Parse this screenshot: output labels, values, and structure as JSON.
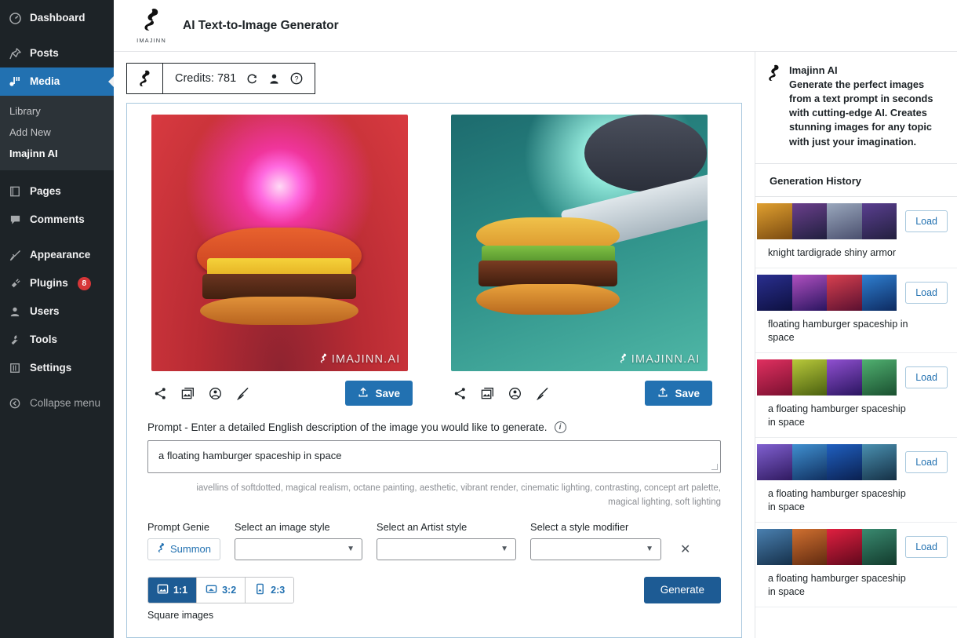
{
  "sidebar": {
    "items": [
      {
        "label": "Dashboard",
        "icon": "dashboard-icon",
        "glyph": "◕"
      },
      {
        "label": "Posts",
        "icon": "pin-icon",
        "glyph": "✚"
      },
      {
        "label": "Media",
        "icon": "media-icon",
        "glyph": "♪",
        "active": true
      },
      {
        "label": "Pages",
        "icon": "pages-icon",
        "glyph": "▤"
      },
      {
        "label": "Comments",
        "icon": "comments-icon",
        "glyph": "▬"
      },
      {
        "label": "Appearance",
        "icon": "brush-icon",
        "glyph": "✎"
      },
      {
        "label": "Plugins",
        "icon": "plug-icon",
        "glyph": "▰",
        "badge": "8"
      },
      {
        "label": "Users",
        "icon": "users-icon",
        "glyph": "♟"
      },
      {
        "label": "Tools",
        "icon": "tools-icon",
        "glyph": "✂"
      },
      {
        "label": "Settings",
        "icon": "settings-icon",
        "glyph": "▣"
      },
      {
        "label": "Collapse menu",
        "icon": "collapse-icon",
        "glyph": "◀"
      }
    ],
    "media_submenu": [
      {
        "label": "Library"
      },
      {
        "label": "Add New"
      },
      {
        "label": "Imajinn AI",
        "current": true
      }
    ]
  },
  "header": {
    "brand_word": "IMAJINN",
    "title": "AI Text-to-Image Generator"
  },
  "credits": {
    "label": "Credits: 781",
    "refresh_icon": "refresh-icon",
    "account_icon": "account-icon",
    "help_icon": "help-icon"
  },
  "results": [
    {
      "watermark": "IMAJINN.AI",
      "save_label": "Save",
      "actions": [
        "share-icon",
        "variations-icon",
        "face-icon",
        "brush-icon"
      ]
    },
    {
      "watermark": "IMAJINN.AI",
      "save_label": "Save",
      "actions": [
        "share-icon",
        "variations-icon",
        "face-icon",
        "brush-icon"
      ]
    }
  ],
  "prompt": {
    "label": "Prompt - Enter a detailed English description of the image you would like to generate.",
    "value": "a floating hamburger spaceship in space",
    "modifiers": "iavellins of softdotted, magical realism, octane painting, aesthetic, vibrant render, cinematic lighting, contrasting, concept art palette, magical lighting, soft lighting"
  },
  "controls": {
    "genie_label": "Prompt Genie",
    "summon_label": "Summon",
    "image_style_label": "Select an image style",
    "image_style_value": "",
    "artist_style_label": "Select an Artist style",
    "artist_style_value": "",
    "style_modifier_label": "Select a style modifier",
    "style_modifier_value": "",
    "clear_icon": "close-icon"
  },
  "bottom": {
    "ratios": [
      {
        "label": "1:1",
        "icon": "landscape-icon",
        "selected": true
      },
      {
        "label": "3:2",
        "icon": "wide-icon",
        "selected": false
      },
      {
        "label": "2:3",
        "icon": "portrait-icon",
        "selected": false
      }
    ],
    "note": "Square images",
    "generate_label": "Generate"
  },
  "right": {
    "about_title": "Imajinn AI",
    "about_desc": "Generate the perfect images from a text prompt in seconds with cutting-edge AI. Creates stunning images for any topic with just your imagination.",
    "history_title": "Generation History",
    "load_label": "Load",
    "history": [
      {
        "caption": "knight tardigrade shiny armor",
        "colors": [
          "#b4791f",
          "#5b3a78",
          "#7d8fa8",
          "#4c3a72"
        ]
      },
      {
        "caption": "floating hamburger spaceship in space",
        "colors": [
          "#2c2a8a",
          "#8b3fa5",
          "#c23b57",
          "#1c5fae"
        ]
      },
      {
        "caption": "a floating hamburger spaceship in space",
        "colors": [
          "#c2185b",
          "#8fae3a",
          "#7b3fb5",
          "#2e7d52"
        ]
      },
      {
        "caption": "a floating hamburger spaceship in space",
        "colors": [
          "#6a4fb5",
          "#2f6fa8",
          "#1b4fa0",
          "#3a6f9e"
        ]
      },
      {
        "caption": "a floating hamburger spaceship in space",
        "colors": [
          "#3b6fa0",
          "#a8582a",
          "#c0203a",
          "#2f6b5a"
        ]
      }
    ]
  },
  "colors": {
    "accent": "#2271b1",
    "accent_dark": "#1d5b94",
    "sidebar_bg": "#1d2327",
    "badge": "#d63638",
    "panel_border": "#a7c7dd"
  }
}
